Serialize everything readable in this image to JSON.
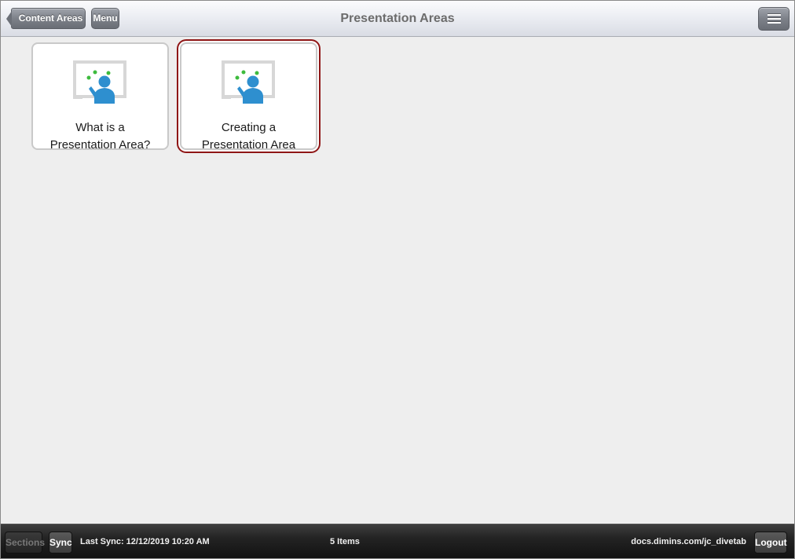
{
  "header": {
    "title": "Presentation Areas",
    "back_label": "Content Areas",
    "menu_label": "Menu",
    "hamburger_icon": "hamburger-menu-icon"
  },
  "tiles": [
    {
      "line1": "What is a",
      "line2": "Presentation Area?",
      "icon": "presentation-icon",
      "selected": false
    },
    {
      "line1": "Creating a",
      "line2": "Presentation Area",
      "icon": "presentation-icon",
      "selected": true
    }
  ],
  "footer": {
    "sections_label": "Sections",
    "sync_label": "Sync",
    "last_sync": "Last Sync: 12/12/2019 10:20 AM",
    "item_count": "5 Items",
    "server": "docs.dimins.com/jc_divetab",
    "logout_label": "Logout"
  },
  "colors": {
    "selection_border": "#8f1616",
    "icon_person": "#2e8fcf",
    "icon_dots": "#3dbb3d",
    "icon_screen": "#d7d7d7"
  }
}
